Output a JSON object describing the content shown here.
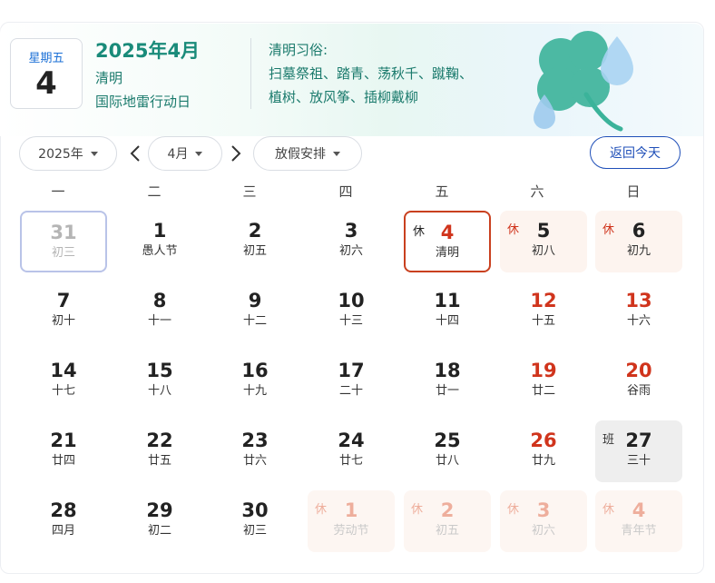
{
  "header": {
    "weekday": "星期五",
    "day": "4",
    "year_month": "2025年4月",
    "festival": "清明",
    "observance": "国际地雷行动日",
    "customs_title": "清明习俗:",
    "customs_line1": "扫墓祭祖、踏青、荡秋千、蹴鞠、",
    "customs_line2": "植树、放风筝、插柳戴柳"
  },
  "controls": {
    "year": "2025年",
    "month": "4月",
    "holiday": "放假安排",
    "today": "返回今天"
  },
  "weekdays": [
    "一",
    "二",
    "三",
    "四",
    "五",
    "六",
    "日"
  ],
  "days": [
    {
      "d": "31",
      "l": "初三",
      "state": "prev",
      "tag": ""
    },
    {
      "d": "1",
      "l": "愚人节",
      "state": "",
      "tag": ""
    },
    {
      "d": "2",
      "l": "初五",
      "state": "",
      "tag": ""
    },
    {
      "d": "3",
      "l": "初六",
      "state": "",
      "tag": ""
    },
    {
      "d": "4",
      "l": "清明",
      "state": "selected",
      "tag": "休"
    },
    {
      "d": "5",
      "l": "初八",
      "state": "rest",
      "tag": "休"
    },
    {
      "d": "6",
      "l": "初九",
      "state": "rest",
      "tag": "休"
    },
    {
      "d": "7",
      "l": "初十",
      "state": "",
      "tag": ""
    },
    {
      "d": "8",
      "l": "十一",
      "state": "",
      "tag": ""
    },
    {
      "d": "9",
      "l": "十二",
      "state": "",
      "tag": ""
    },
    {
      "d": "10",
      "l": "十三",
      "state": "",
      "tag": ""
    },
    {
      "d": "11",
      "l": "十四",
      "state": "",
      "tag": ""
    },
    {
      "d": "12",
      "l": "十五",
      "state": "red",
      "tag": ""
    },
    {
      "d": "13",
      "l": "十六",
      "state": "red",
      "tag": ""
    },
    {
      "d": "14",
      "l": "十七",
      "state": "",
      "tag": ""
    },
    {
      "d": "15",
      "l": "十八",
      "state": "",
      "tag": ""
    },
    {
      "d": "16",
      "l": "十九",
      "state": "",
      "tag": ""
    },
    {
      "d": "17",
      "l": "二十",
      "state": "",
      "tag": ""
    },
    {
      "d": "18",
      "l": "廿一",
      "state": "",
      "tag": ""
    },
    {
      "d": "19",
      "l": "廿二",
      "state": "red",
      "tag": ""
    },
    {
      "d": "20",
      "l": "谷雨",
      "state": "red",
      "tag": ""
    },
    {
      "d": "21",
      "l": "廿四",
      "state": "",
      "tag": ""
    },
    {
      "d": "22",
      "l": "廿五",
      "state": "",
      "tag": ""
    },
    {
      "d": "23",
      "l": "廿六",
      "state": "",
      "tag": ""
    },
    {
      "d": "24",
      "l": "廿七",
      "state": "",
      "tag": ""
    },
    {
      "d": "25",
      "l": "廿八",
      "state": "",
      "tag": ""
    },
    {
      "d": "26",
      "l": "廿九",
      "state": "red",
      "tag": ""
    },
    {
      "d": "27",
      "l": "三十",
      "state": "work",
      "tag": "班"
    },
    {
      "d": "28",
      "l": "四月",
      "state": "",
      "tag": ""
    },
    {
      "d": "29",
      "l": "初二",
      "state": "",
      "tag": ""
    },
    {
      "d": "30",
      "l": "初三",
      "state": "",
      "tag": ""
    },
    {
      "d": "1",
      "l": "劳动节",
      "state": "next",
      "tag": "休"
    },
    {
      "d": "2",
      "l": "初五",
      "state": "next",
      "tag": "休"
    },
    {
      "d": "3",
      "l": "初六",
      "state": "next",
      "tag": "休"
    },
    {
      "d": "4",
      "l": "青年节",
      "state": "next",
      "tag": "休"
    }
  ],
  "colors": {
    "accent_green": "#1a8b7a",
    "holiday_red": "#d0341c",
    "today_blue": "#1f4fb8"
  },
  "icons": [
    "clover-decoration-icon",
    "chevron-left-icon",
    "chevron-right-icon",
    "caret-down-icon"
  ]
}
